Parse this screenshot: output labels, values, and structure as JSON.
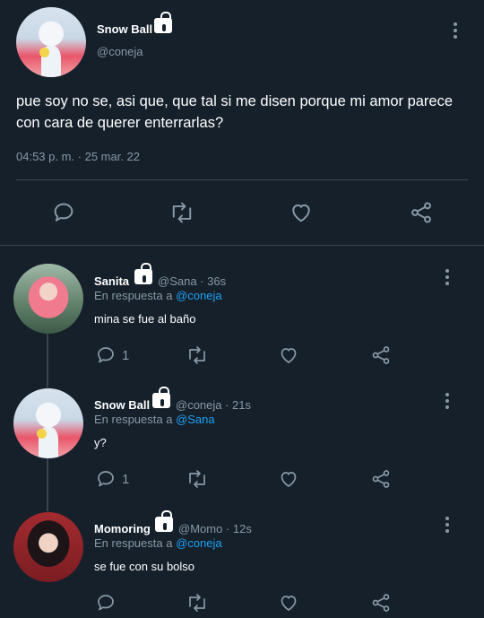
{
  "main_tweet": {
    "author_name": "Snow Ball",
    "author_handle": "@coneja",
    "text": "pue soy no se, asi que, que tal si me disen porque mi amor parece con cara de querer enterrarlas?",
    "timestamp": "04:53 p. m. · 25 mar. 22"
  },
  "replies": [
    {
      "name": "Sanita",
      "handle": "@Sana",
      "time": "36s",
      "meta": "@Sana · 36s",
      "reply_prefix": "En respuesta a ",
      "reply_to": "@coneja",
      "text": "mina se fue al baño",
      "reply_count": "1"
    },
    {
      "name": "Snow Ball",
      "handle": "@coneja",
      "time": "21s",
      "meta": "@coneja · 21s",
      "reply_prefix": "En respuesta a ",
      "reply_to": "@Sana",
      "text": "y?",
      "reply_count": "1"
    },
    {
      "name": "Momoring",
      "handle": "@Momo",
      "time": "12s",
      "meta": "@Momo · 12s",
      "reply_prefix": "En respuesta a ",
      "reply_to": "@coneja",
      "text": "se fue con su bolso",
      "reply_count": ""
    }
  ],
  "icons": {
    "reply": "reply-icon",
    "retweet": "retweet-icon",
    "like": "heart-icon",
    "share": "share-icon",
    "more": "more-icon",
    "lock": "lock-icon"
  },
  "colors": {
    "background": "#15202b",
    "text": "#ffffff",
    "secondary": "#8899a6",
    "link": "#1da1f2",
    "divider": "#38444d"
  }
}
